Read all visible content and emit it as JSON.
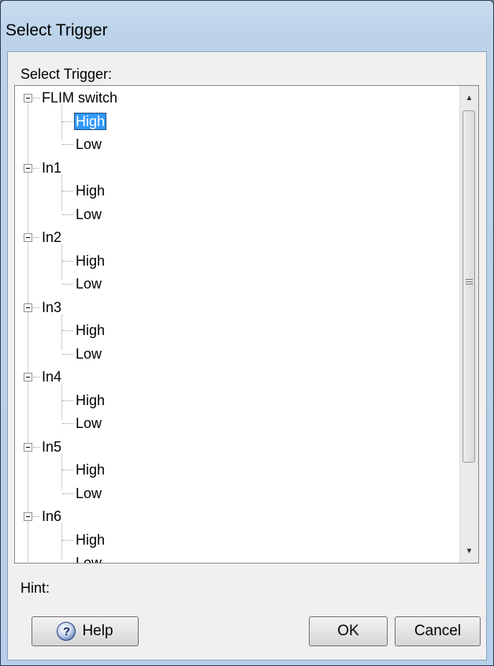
{
  "window": {
    "title": "Select Trigger"
  },
  "group": {
    "label": "Select Trigger:"
  },
  "tree": [
    {
      "label": "FLIM switch",
      "children": [
        "High",
        "Low"
      ]
    },
    {
      "label": "In1",
      "children": [
        "High",
        "Low"
      ]
    },
    {
      "label": "In2",
      "children": [
        "High",
        "Low"
      ]
    },
    {
      "label": "In3",
      "children": [
        "High",
        "Low"
      ]
    },
    {
      "label": "In4",
      "children": [
        "High",
        "Low"
      ]
    },
    {
      "label": "In5",
      "children": [
        "High",
        "Low"
      ]
    },
    {
      "label": "In6",
      "children": [
        "High",
        "Low"
      ]
    }
  ],
  "selected": "FLIM switch / High",
  "hint": {
    "label": "Hint:"
  },
  "buttons": {
    "help": "Help",
    "ok": "OK",
    "cancel": "Cancel"
  },
  "icons": {
    "help": "question-mark-circle-icon",
    "scroll_up": "arrow-up-icon",
    "scroll_down": "arrow-down-icon"
  }
}
